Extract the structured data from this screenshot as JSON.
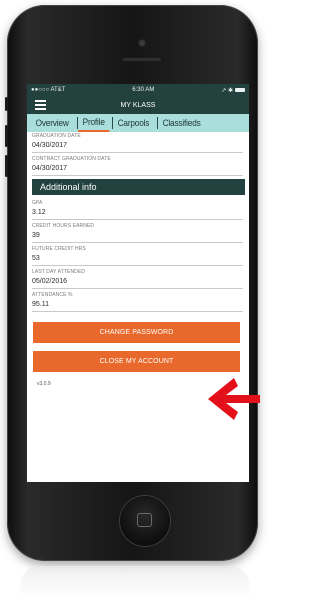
{
  "status_bar": {
    "carrier": "●●○○○ AT&T",
    "time": "6:30 AM",
    "right": "↗ ✱"
  },
  "nav": {
    "title": "MY KLASS"
  },
  "tabs": [
    {
      "label": "Overview",
      "active": false
    },
    {
      "label": "Profile",
      "active": true
    },
    {
      "label": "Carpools",
      "active": false
    },
    {
      "label": "Classifieds",
      "active": false
    }
  ],
  "fields_top": [
    {
      "label": "GRADUATION DATE",
      "value": "04/30/2017"
    },
    {
      "label": "CONTRACT GRADUATION DATE",
      "value": "04/30/2017"
    }
  ],
  "section_title": "Additional info",
  "fields_additional": [
    {
      "label": "GPA",
      "value": "3.12"
    },
    {
      "label": "CREDIT HOURS EARNED",
      "value": "39"
    },
    {
      "label": "FUTURE CREDIT HRS",
      "value": "53"
    },
    {
      "label": "LAST DAY ATTENDED",
      "value": "05/02/2016"
    },
    {
      "label": "ATTENDANCE %",
      "value": "95.11"
    }
  ],
  "buttons": {
    "change_password": "CHANGE PASSWORD",
    "close_account": "CLOSE MY ACCOUNT"
  },
  "version": "v3.0.9",
  "colors": {
    "header": "#23423f",
    "tabs": "#a9dedd",
    "accent": "#e8692b",
    "arrow": "#e3101b"
  }
}
